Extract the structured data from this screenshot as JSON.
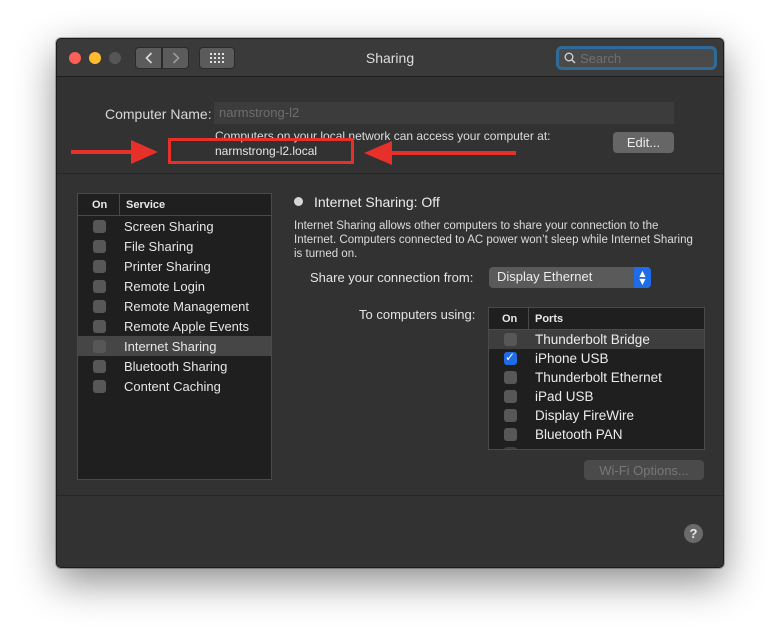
{
  "window": {
    "title": "Sharing"
  },
  "search": {
    "placeholder": "Search",
    "value": ""
  },
  "computer_name": {
    "label": "Computer Name:",
    "value": "narmstrong-l2",
    "note": "Computers on your local network can access your computer at:",
    "hostname": "narmstrong-l2.local",
    "edit_label": "Edit..."
  },
  "services": {
    "col_on": "On",
    "col_service": "Service",
    "items": [
      {
        "label": "Screen Sharing",
        "on": false,
        "selected": false
      },
      {
        "label": "File Sharing",
        "on": false,
        "selected": false
      },
      {
        "label": "Printer Sharing",
        "on": false,
        "selected": false
      },
      {
        "label": "Remote Login",
        "on": false,
        "selected": false
      },
      {
        "label": "Remote Management",
        "on": false,
        "selected": false
      },
      {
        "label": "Remote Apple Events",
        "on": false,
        "selected": false
      },
      {
        "label": "Internet Sharing",
        "on": false,
        "selected": true
      },
      {
        "label": "Bluetooth Sharing",
        "on": false,
        "selected": false
      },
      {
        "label": "Content Caching",
        "on": false,
        "selected": false
      }
    ]
  },
  "detail": {
    "status": "Internet Sharing: Off",
    "description": "Internet Sharing allows other computers to share your connection to the Internet. Computers connected to AC power won’t sleep while Internet Sharing is turned on.",
    "share_from_label": "Share your connection from:",
    "share_from_value": "Display Ethernet",
    "to_computers_label": "To computers using:",
    "ports": {
      "col_on": "On",
      "col_ports": "Ports",
      "items": [
        {
          "label": "Thunderbolt Bridge",
          "on": false,
          "highlighted": true
        },
        {
          "label": "iPhone USB",
          "on": true,
          "highlighted": false
        },
        {
          "label": "Thunderbolt Ethernet",
          "on": false,
          "highlighted": false
        },
        {
          "label": "iPad USB",
          "on": false,
          "highlighted": false
        },
        {
          "label": "Display FireWire",
          "on": false,
          "highlighted": false
        },
        {
          "label": "Bluetooth PAN",
          "on": false,
          "highlighted": false
        }
      ]
    },
    "wifi_options_label": "Wi-Fi Options...",
    "help_label": "?"
  },
  "colors": {
    "window_bg": "#323232",
    "accent": "#1f6ce6",
    "annotation": "#e8302a"
  }
}
